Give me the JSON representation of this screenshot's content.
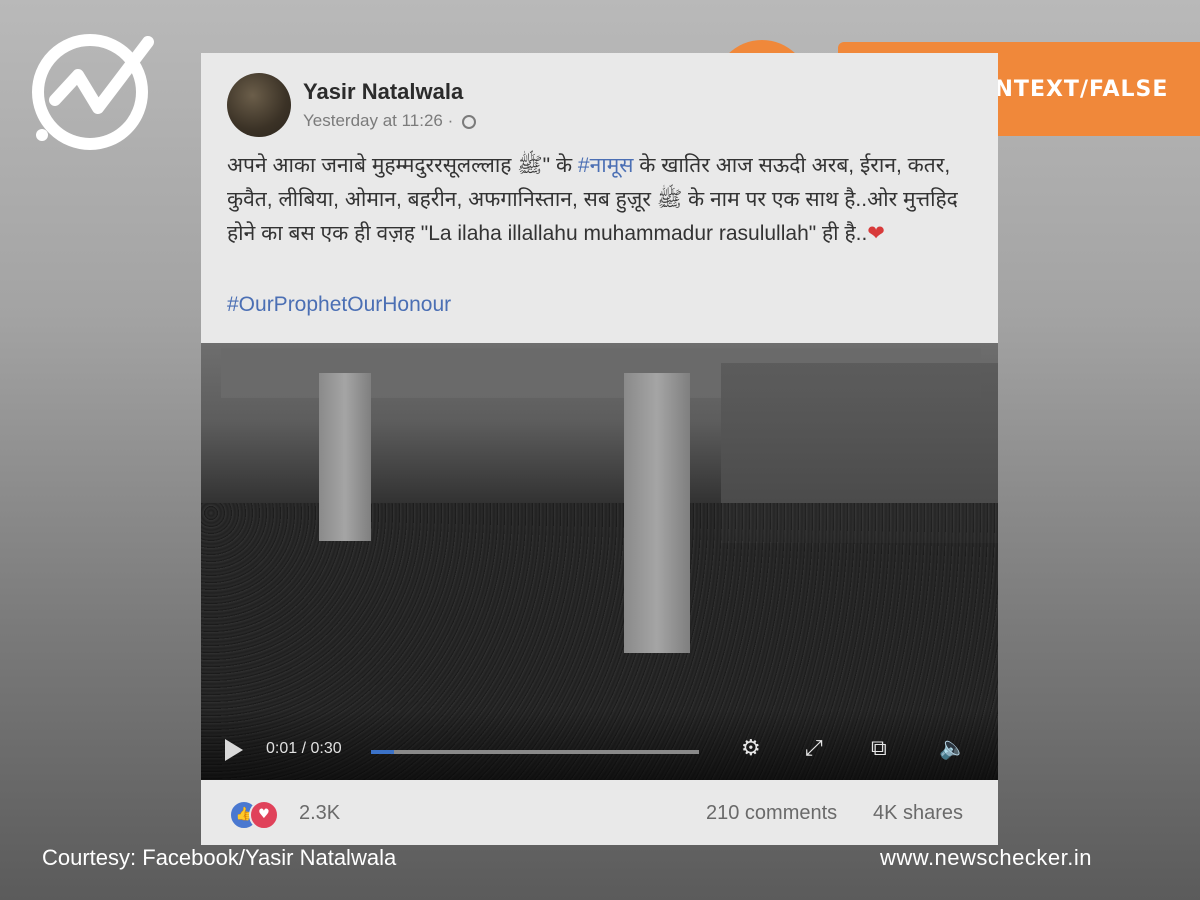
{
  "colors": {
    "accent": "#f0883a",
    "link": "#4b6fb4",
    "card_bg": "#e9e9e9"
  },
  "overlay": {
    "verdict": "FALSE CONTEXT/FALSE",
    "verdict_icon": "false-stripes-icon",
    "logo_icon": "newschecker-logo-icon"
  },
  "post": {
    "author": "Yasir Natalwala",
    "timestamp": "Yesterday at 11:26 ·",
    "body_line1_a": "अपने  आका जनाबे मुहम्मदुररसूलल्लाह ﷺ\"  के ",
    "body_hashtag": "#नामूस",
    "body_line1_b": " के खातिर आज सऊदी अरब,  ईरान, कतर, कुवैत, लीबिया, ओमान, बहरीन, अफगानिस्तान, सब हुज़ूर ﷺ के नाम पर एक साथ है..ओर  मुत्तहिद होने का बस एक ही वज़ह \"La ilaha illallahu muhammadur rasulullah\" ही है..",
    "heart": "❤",
    "tag": "#OurProphetOurHonour"
  },
  "video": {
    "time": "0:01 / 0:30",
    "progress": 0.07
  },
  "footer": {
    "reactions": "2.3K",
    "comments": "210 comments",
    "shares": "4K shares"
  },
  "caption": {
    "courtesy": "Courtesy: Facebook/Yasir Natalwala",
    "site": "www.newschecker.in"
  }
}
